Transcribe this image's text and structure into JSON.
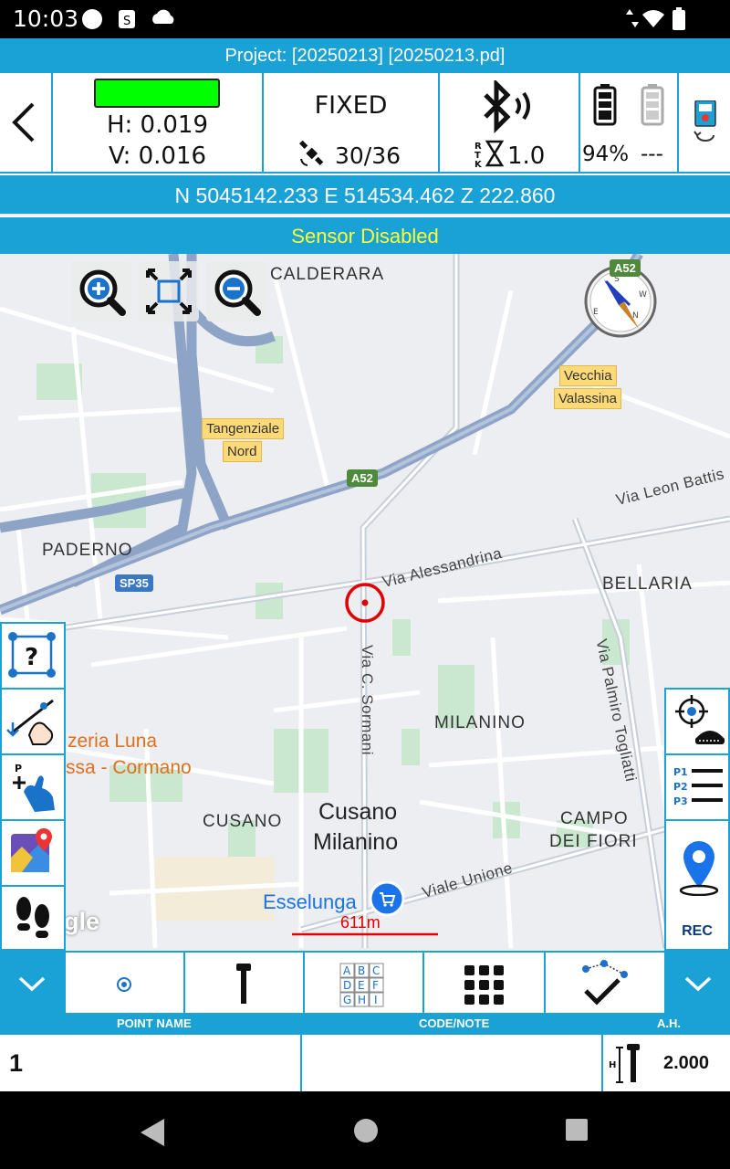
{
  "status_bar": {
    "time": "10:03"
  },
  "project": {
    "title": "Project: [20250213] [20250213.pd]"
  },
  "gnss": {
    "h_precision": "H: 0.019",
    "v_precision": "V: 0.016",
    "fix_status": "FIXED",
    "satellites": "30/36",
    "rtk_age": "1.0",
    "battery_1": "94%",
    "battery_2": "---"
  },
  "coordinates": "N 5045142.233 E 514534.462 Z 222.860",
  "sensor_status": "Sensor Disabled",
  "map": {
    "labels": {
      "calderara": "CALDERARA",
      "paderno": "PADERNO",
      "bellaria": "BELLARIA",
      "milanino": "MILANINO",
      "cusano": "CUSANO",
      "cusano_milanino_1": "Cusano",
      "cusano_milanino_2": "Milanino",
      "campo_dei_fiori_1": "CAMPO",
      "campo_dei_fiori_2": "DEI FIORI",
      "via_alessandrina": "Via Alessandrina",
      "via_leon": "Via Leon Battis",
      "via_sormani": "Via C. Sormani",
      "via_togliatti": "Via Palmiro Togliatti",
      "viale_unione": "Viale Unione",
      "pizzeria_1": "zeria Luna",
      "pizzeria_2": "ssa - Cormano",
      "esselunga": "Esselunga",
      "google": "gle",
      "tangenziale_1": "Tangenziale",
      "tangenziale_2": "Nord",
      "vecchia_1": "Vecchia",
      "vecchia_2": "Valassina",
      "a52_top": "A52",
      "a52": "A52",
      "sp35": "SP35"
    },
    "scale": "611m"
  },
  "side_right": {
    "rec_label": "REC"
  },
  "fields": {
    "point_name_header": "POINT NAME",
    "code_note_header": "CODE/NOTE",
    "ah_header": "A.H.",
    "point_name_value": "1",
    "code_note_value": "",
    "ah_value": "2.000"
  },
  "colors": {
    "accent": "#1aa1d6",
    "gps_ok": "#00ff00",
    "sensor_text": "#ffff33",
    "target": "#e00000"
  }
}
